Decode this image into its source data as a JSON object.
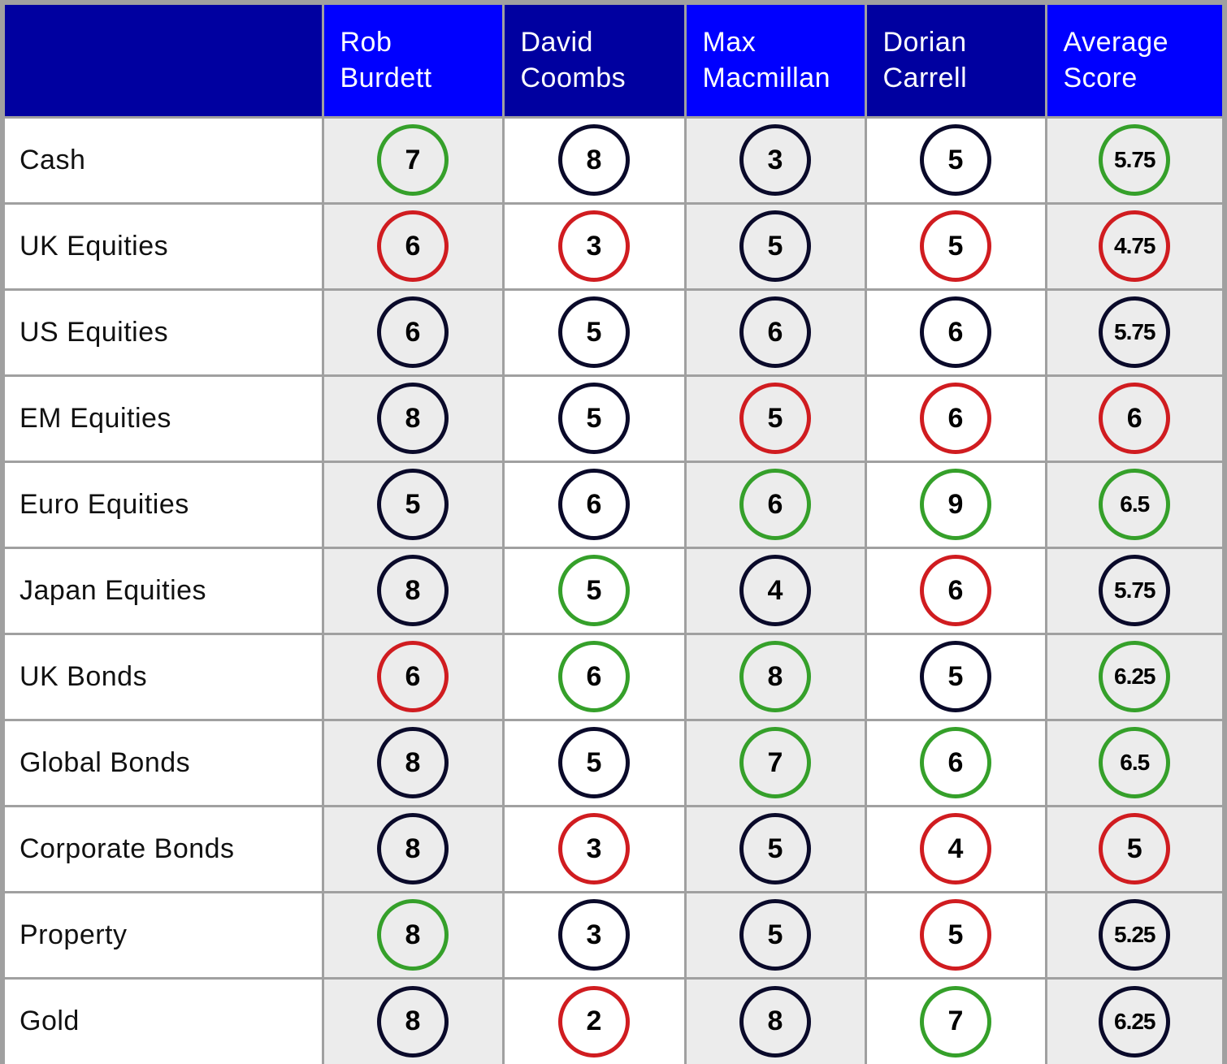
{
  "table": {
    "corner_label": "",
    "columns": [
      {
        "label": "Rob\nBurdett",
        "line1": "Rob",
        "line2": "Burdett",
        "header_style": "bright",
        "shaded": true
      },
      {
        "label": "David\nCoombs",
        "line1": "David",
        "line2": "Coombs",
        "header_style": "dark",
        "shaded": false
      },
      {
        "label": "Max\nMacmillan",
        "line1": "Max",
        "line2": "Macmillan",
        "header_style": "bright",
        "shaded": true
      },
      {
        "label": "Dorian\nCarrell",
        "line1": "Dorian",
        "line2": "Carrell",
        "header_style": "dark",
        "shaded": false
      },
      {
        "label": "Average\nScore",
        "line1": "Average",
        "line2": "Score",
        "header_style": "bright",
        "shaded": true
      }
    ],
    "rows": [
      {
        "label": "Cash",
        "cells": [
          {
            "value": "7",
            "status": "green"
          },
          {
            "value": "8",
            "status": "neutral"
          },
          {
            "value": "3",
            "status": "neutral"
          },
          {
            "value": "5",
            "status": "neutral"
          },
          {
            "value": "5.75",
            "status": "green"
          }
        ]
      },
      {
        "label": "UK Equities",
        "cells": [
          {
            "value": "6",
            "status": "red"
          },
          {
            "value": "3",
            "status": "red"
          },
          {
            "value": "5",
            "status": "neutral"
          },
          {
            "value": "5",
            "status": "red"
          },
          {
            "value": "4.75",
            "status": "red"
          }
        ]
      },
      {
        "label": "US Equities",
        "cells": [
          {
            "value": "6",
            "status": "neutral"
          },
          {
            "value": "5",
            "status": "neutral"
          },
          {
            "value": "6",
            "status": "neutral"
          },
          {
            "value": "6",
            "status": "neutral"
          },
          {
            "value": "5.75",
            "status": "neutral"
          }
        ]
      },
      {
        "label": "EM Equities",
        "cells": [
          {
            "value": "8",
            "status": "neutral"
          },
          {
            "value": "5",
            "status": "neutral"
          },
          {
            "value": "5",
            "status": "red"
          },
          {
            "value": "6",
            "status": "red"
          },
          {
            "value": "6",
            "status": "red"
          }
        ]
      },
      {
        "label": "Euro Equities",
        "cells": [
          {
            "value": "5",
            "status": "neutral"
          },
          {
            "value": "6",
            "status": "neutral"
          },
          {
            "value": "6",
            "status": "green"
          },
          {
            "value": "9",
            "status": "green"
          },
          {
            "value": "6.5",
            "status": "green"
          }
        ]
      },
      {
        "label": "Japan Equities",
        "cells": [
          {
            "value": "8",
            "status": "neutral"
          },
          {
            "value": "5",
            "status": "green"
          },
          {
            "value": "4",
            "status": "neutral"
          },
          {
            "value": "6",
            "status": "red"
          },
          {
            "value": "5.75",
            "status": "neutral"
          }
        ]
      },
      {
        "label": "UK Bonds",
        "cells": [
          {
            "value": "6",
            "status": "red"
          },
          {
            "value": "6",
            "status": "green"
          },
          {
            "value": "8",
            "status": "green"
          },
          {
            "value": "5",
            "status": "neutral"
          },
          {
            "value": "6.25",
            "status": "green"
          }
        ]
      },
      {
        "label": "Global Bonds",
        "cells": [
          {
            "value": "8",
            "status": "neutral"
          },
          {
            "value": "5",
            "status": "neutral"
          },
          {
            "value": "7",
            "status": "green"
          },
          {
            "value": "6",
            "status": "green"
          },
          {
            "value": "6.5",
            "status": "green"
          }
        ]
      },
      {
        "label": "Corporate Bonds",
        "cells": [
          {
            "value": "8",
            "status": "neutral"
          },
          {
            "value": "3",
            "status": "red"
          },
          {
            "value": "5",
            "status": "neutral"
          },
          {
            "value": "4",
            "status": "red"
          },
          {
            "value": "5",
            "status": "red"
          }
        ]
      },
      {
        "label": "Property",
        "cells": [
          {
            "value": "8",
            "status": "green"
          },
          {
            "value": "3",
            "status": "neutral"
          },
          {
            "value": "5",
            "status": "neutral"
          },
          {
            "value": "5",
            "status": "red"
          },
          {
            "value": "5.25",
            "status": "neutral"
          }
        ]
      },
      {
        "label": "Gold",
        "cells": [
          {
            "value": "8",
            "status": "neutral"
          },
          {
            "value": "2",
            "status": "red"
          },
          {
            "value": "8",
            "status": "neutral"
          },
          {
            "value": "7",
            "status": "green"
          },
          {
            "value": "6.25",
            "status": "neutral"
          }
        ]
      }
    ]
  },
  "colors": {
    "header_dark": "#0000a0",
    "header_bright": "#0000ff",
    "status_green": "#35a02a",
    "status_red": "#d01c20",
    "status_neutral": "#0a0a2a",
    "shaded_cell": "#ececec",
    "grid": "#a0a0a0"
  }
}
